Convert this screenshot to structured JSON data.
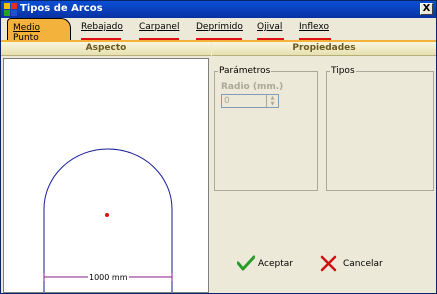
{
  "window": {
    "title": "Tipos de Arcos",
    "close_label": "X"
  },
  "tabs": [
    {
      "label": "Medio Punto",
      "active": true
    },
    {
      "label": "Rebajado",
      "active": false
    },
    {
      "label": "Carpanel",
      "active": false
    },
    {
      "label": "Deprimido",
      "active": false
    },
    {
      "label": "Ojival",
      "active": false
    },
    {
      "label": "Inflexo",
      "active": false
    }
  ],
  "sections": {
    "left_header": "Aspecto",
    "right_header": "Propiedades"
  },
  "preview": {
    "dimension_label": "1000 mm"
  },
  "parametros": {
    "legend": "Parámetros",
    "radio_label": "Radio (mm.)",
    "radio_value": "0"
  },
  "tipos": {
    "legend": "Tipos"
  },
  "buttons": {
    "accept_label": "Aceptar",
    "cancel_label": "Cancelar"
  },
  "colors": {
    "active_tab": "#f2b23c",
    "tab_underline": "#e01010",
    "titlebar": "#0a4fd4",
    "arch_stroke": "#1a1a9a",
    "center_point": "#e01010"
  }
}
